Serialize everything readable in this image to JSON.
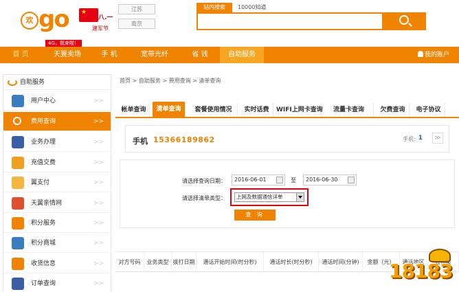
{
  "header": {
    "logo_text": "go",
    "logo_badge": "欢",
    "slogan_top": "八.一",
    "slogan_bottom": "建军节",
    "province_btn_1": "江苏",
    "province_btn_2": "南京",
    "search_tab_active": "站内搜索",
    "search_tab_2": "10000知道",
    "search_placeholder": ""
  },
  "nav": {
    "badge": "4G，我来啦！",
    "items": [
      "首 页",
      "天翼卖场",
      "手 机",
      "宽带光纤",
      "省 钱",
      "自助服务"
    ],
    "account": "我的账户"
  },
  "sidebar": {
    "title": "自助服务",
    "items": [
      {
        "label": "用户中心",
        "icon": "user-icon",
        "color": "#3a7cc1"
      },
      {
        "label": "费用查询",
        "icon": "search-icon",
        "color": "#ffffff",
        "active": true
      },
      {
        "label": "业务办理",
        "icon": "document-icon",
        "color": "#3a5fa6"
      },
      {
        "label": "充值交费",
        "icon": "yen-coin-icon",
        "color": "#f0a020"
      },
      {
        "label": "翼支付",
        "icon": "wallet-icon",
        "color": "#f6b53d"
      },
      {
        "label": "天翼亲情网",
        "icon": "family-network-icon",
        "color": "#e05030"
      },
      {
        "label": "积分服务",
        "icon": "points-icon",
        "color": "#f08300"
      },
      {
        "label": "积分商城",
        "icon": "mall-icon",
        "color": "#3a7cc1"
      },
      {
        "label": "收货信息",
        "icon": "delivery-icon",
        "color": "#f08300"
      },
      {
        "label": "订单查询",
        "icon": "order-icon",
        "color": "#3a5fa6"
      }
    ],
    "arrow": ">>"
  },
  "breadcrumb": "首页  >  自助服务  >  费用查询  >  清单查询",
  "tabs": [
    "帐单查询",
    "清单查询",
    "套餐使用情况",
    "实时话费",
    "WIFI上网卡查询",
    "流量卡查询",
    "欠费查询",
    "电子协议"
  ],
  "phone_panel": {
    "label": "手机",
    "number": "15366189862",
    "count_label": "手机:",
    "count_value": "1",
    "toggle": "≫"
  },
  "query": {
    "date_label": "请选择查询日期：",
    "date_start": "2016-06-01",
    "date_to": "至",
    "date_end": "2016-06-30",
    "type_label": "请选择清单类型：",
    "type_value": "上网及数据通信详单",
    "button": "查 询"
  },
  "result_columns": [
    "对方号码",
    "业务类型",
    "拨打日期",
    "通话开始时间(时分秒)",
    "通话时长(时分秒)",
    "通话时间(分钟)",
    "金额（元）",
    "通话地区",
    "通话类"
  ],
  "watermark": "18183"
}
